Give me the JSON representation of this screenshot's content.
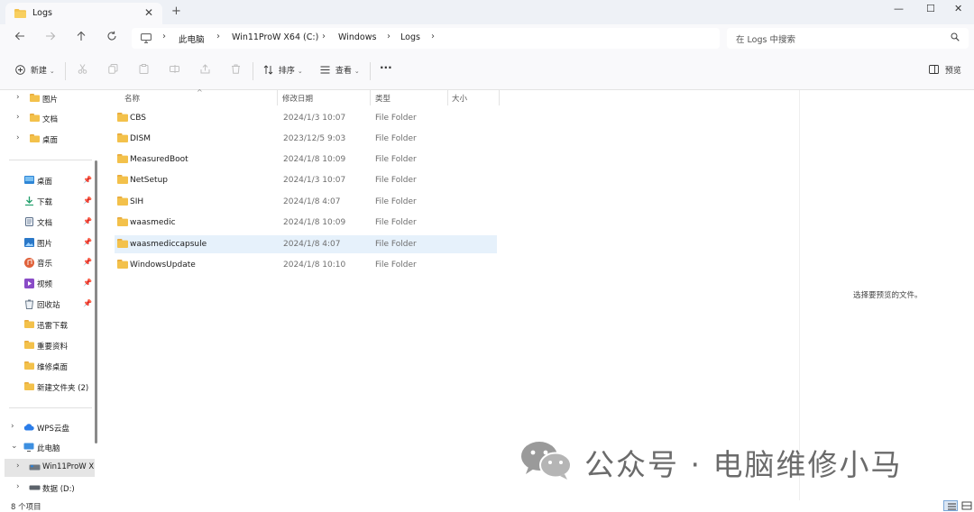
{
  "window": {
    "tab_title": "Logs",
    "new_tab": "+",
    "close_tab": "✕",
    "controls": {
      "minimize": "—",
      "maximize": "☐",
      "close": "✕"
    }
  },
  "address": {
    "crumbs": [
      "此电脑",
      "Win11ProW X64 (C:)",
      "Windows",
      "Logs"
    ],
    "search_placeholder": "在 Logs 中搜索"
  },
  "toolbar": {
    "new": "新建",
    "sort": "排序",
    "view": "查看",
    "more": "···",
    "preview": "预览"
  },
  "sidebar": {
    "top_items": [
      {
        "label": "图片"
      },
      {
        "label": "文档"
      },
      {
        "label": "桌面"
      }
    ],
    "quick_access": [
      {
        "label": "桌面",
        "icon": "desktop-icon"
      },
      {
        "label": "下载",
        "icon": "download-icon"
      },
      {
        "label": "文档",
        "icon": "document-icon"
      },
      {
        "label": "图片",
        "icon": "picture-icon"
      },
      {
        "label": "音乐",
        "icon": "music-icon"
      },
      {
        "label": "视频",
        "icon": "video-icon"
      },
      {
        "label": "回收站",
        "icon": "recycle-bin-icon"
      },
      {
        "label": "迅雷下载",
        "icon": "folder-icon"
      },
      {
        "label": "重要资料",
        "icon": "folder-icon"
      },
      {
        "label": "维修桌面",
        "icon": "folder-icon"
      },
      {
        "label": "新建文件夹 (2)",
        "icon": "folder-icon"
      }
    ],
    "bottom_items": [
      {
        "label": "WPS云盘"
      },
      {
        "label": "此电脑"
      },
      {
        "label": "Win11ProW X"
      },
      {
        "label": "数据 (D:)"
      }
    ]
  },
  "list": {
    "columns": [
      "名称",
      "修改日期",
      "类型",
      "大小"
    ],
    "rows": [
      {
        "name": "CBS",
        "date": "2024/1/3 10:07",
        "type": "File Folder"
      },
      {
        "name": "DISM",
        "date": "2023/12/5 9:03",
        "type": "File Folder"
      },
      {
        "name": "MeasuredBoot",
        "date": "2024/1/8 10:09",
        "type": "File Folder"
      },
      {
        "name": "NetSetup",
        "date": "2024/1/3 10:07",
        "type": "File Folder"
      },
      {
        "name": "SIH",
        "date": "2024/1/8 4:07",
        "type": "File Folder"
      },
      {
        "name": "waasmedic",
        "date": "2024/1/8 10:09",
        "type": "File Folder"
      },
      {
        "name": "waasmediccapsule",
        "date": "2024/1/8 4:07",
        "type": "File Folder"
      },
      {
        "name": "WindowsUpdate",
        "date": "2024/1/8 10:10",
        "type": "File Folder"
      }
    ]
  },
  "preview": {
    "empty_text": "选择要预览的文件。"
  },
  "watermark": {
    "text": "公众号 · 电脑维修小马"
  },
  "status": {
    "item_count": "8 个项目"
  },
  "colors": {
    "folder": "#f3c14b",
    "selection": "#e6f1fb",
    "accent": "#0067c0"
  }
}
